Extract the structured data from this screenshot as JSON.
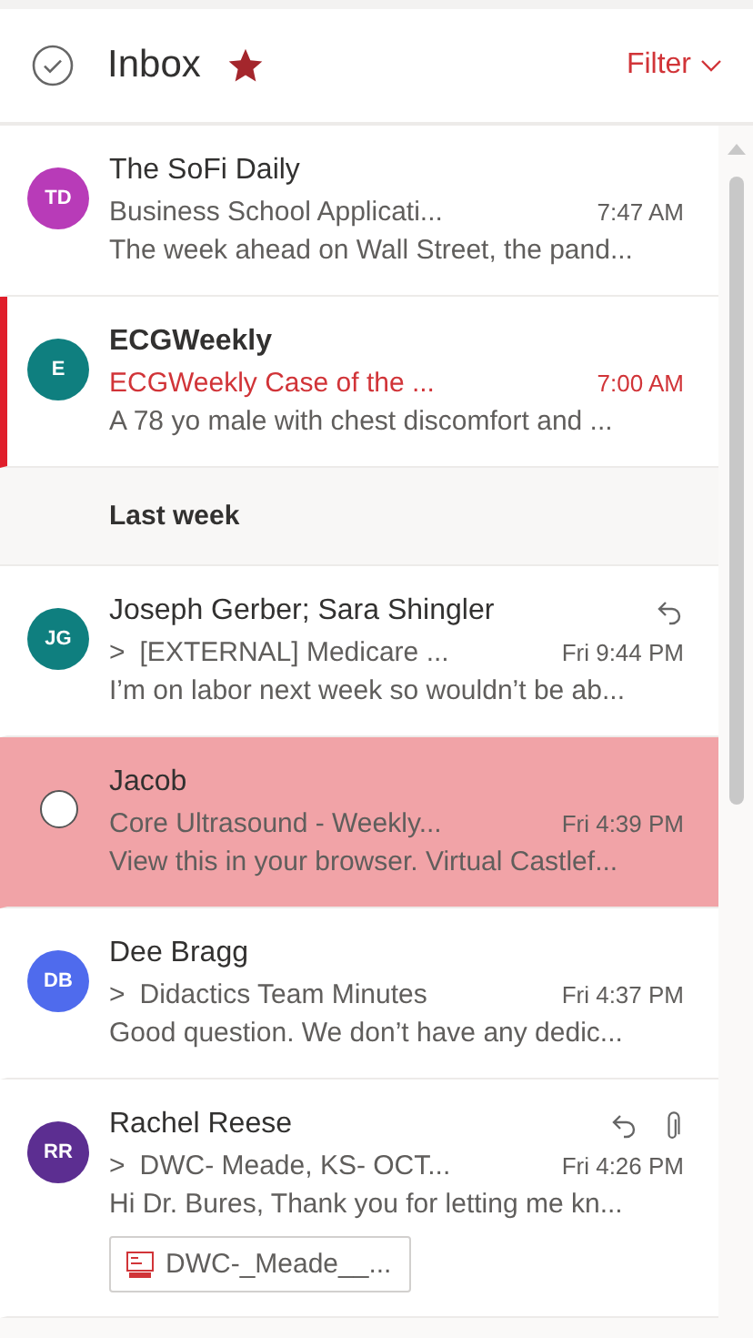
{
  "header": {
    "title": "Inbox",
    "favorite": true,
    "filter_label": "Filter"
  },
  "items": [
    {
      "kind": "message",
      "sender": "The SoFi Daily",
      "subject": "Business School Applicati...",
      "time": "7:47 AM",
      "preview": "The week ahead on Wall Street, the pand...",
      "avatar": {
        "initials": "TD",
        "color": "#b83bb8"
      },
      "selected": false,
      "unread": false,
      "replied": false,
      "has_attachment": false
    },
    {
      "kind": "message",
      "sender": "ECGWeekly",
      "subject": "ECGWeekly Case of the ...",
      "time": "7:00 AM",
      "preview": "A 78 yo male with chest discomfort and ...",
      "avatar": {
        "initials": "E",
        "color": "#0f7f7f"
      },
      "selected": false,
      "unread": true,
      "replied": false,
      "has_attachment": false
    },
    {
      "kind": "section",
      "label": "Last week"
    },
    {
      "kind": "message",
      "sender": "Joseph Gerber; Sara Shingler",
      "thread_marker": ">",
      "subject": "[EXTERNAL] Medicare ...",
      "time": "Fri 9:44 PM",
      "preview": "I’m on labor next week so wouldn’t be ab...",
      "avatar": {
        "initials": "JG",
        "color": "#0f7f7f"
      },
      "selected": false,
      "unread": false,
      "replied": true,
      "has_attachment": false
    },
    {
      "kind": "message",
      "sender": "Jacob",
      "subject": "Core Ultrasound - Weekly...",
      "time": "Fri 4:39 PM",
      "preview": "View this in your browser. Virtual Castlef...",
      "selected": true,
      "unread": false,
      "replied": false,
      "has_attachment": false
    },
    {
      "kind": "message",
      "sender": "Dee Bragg",
      "thread_marker": ">",
      "subject": "Didactics Team Minutes",
      "time": "Fri 4:37 PM",
      "preview": "Good question. We don’t have any dedic...",
      "avatar": {
        "initials": "DB",
        "color": "#4f6bed"
      },
      "selected": false,
      "unread": false,
      "replied": false,
      "has_attachment": false
    },
    {
      "kind": "message",
      "sender": "Rachel Reese",
      "thread_marker": ">",
      "subject": "DWC- Meade, KS- OCT...",
      "time": "Fri 4:26 PM",
      "preview": "Hi Dr. Bures, Thank you for letting me kn...",
      "avatar": {
        "initials": "RR",
        "color": "#5c2e91"
      },
      "selected": false,
      "unread": false,
      "replied": true,
      "has_attachment": true,
      "attachment_name": "DWC-_Meade__..."
    }
  ]
}
